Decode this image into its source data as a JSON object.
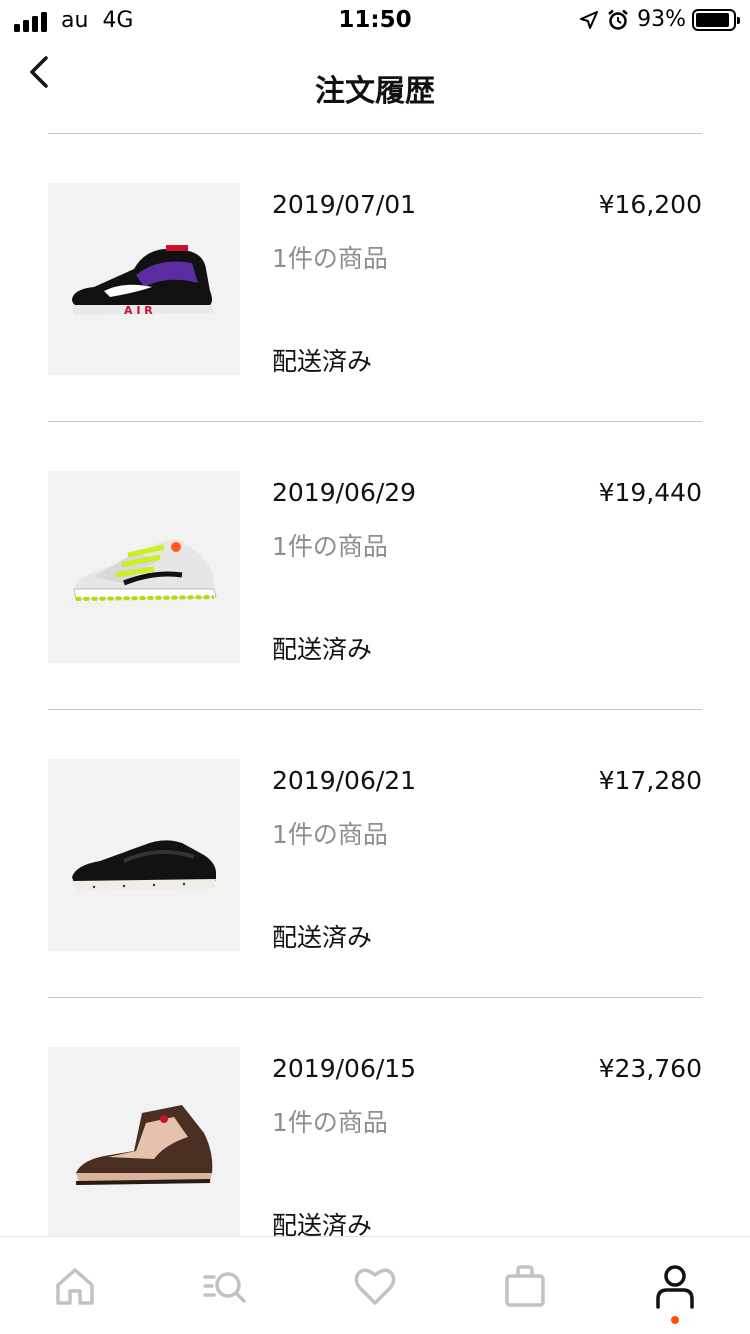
{
  "status_bar": {
    "carrier": "au",
    "network": "4G",
    "time": "11:50",
    "battery": "93%",
    "battery_level": 0.93
  },
  "header": {
    "title": "注文履歴",
    "back_icon": "chevron-left-icon"
  },
  "orders": [
    {
      "date": "2019/07/01",
      "price": "¥16,200",
      "items": "1件の商品",
      "status": "配送済み",
      "image": "sneaker-black-purple-air"
    },
    {
      "date": "2019/06/29",
      "price": "¥19,440",
      "items": "1件の商品",
      "status": "配送済み",
      "image": "sneaker-white-volt"
    },
    {
      "date": "2019/06/21",
      "price": "¥17,280",
      "items": "1件の商品",
      "status": "配送済み",
      "image": "sneaker-black-low"
    },
    {
      "date": "2019/06/15",
      "price": "¥23,760",
      "items": "1件の商品",
      "status": "配送済み",
      "image": "sneaker-brown-high"
    }
  ],
  "tab_bar": {
    "tabs": [
      {
        "icon": "home-icon",
        "active": false
      },
      {
        "icon": "search-list-icon",
        "active": false
      },
      {
        "icon": "heart-icon",
        "active": false
      },
      {
        "icon": "bag-icon",
        "active": false
      },
      {
        "icon": "profile-icon",
        "active": true
      }
    ],
    "inactive_color": "#c2c2c2",
    "active_color": "#111111",
    "badge_color": "#fa5400"
  }
}
